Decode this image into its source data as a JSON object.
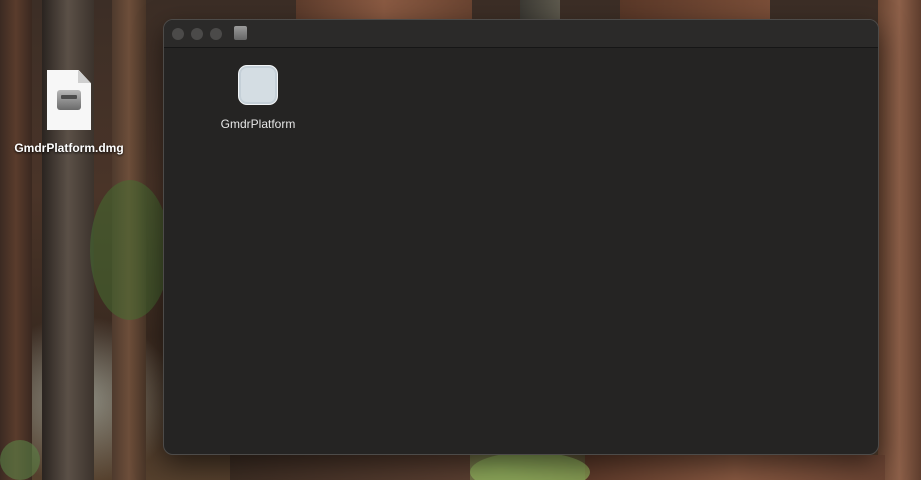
{
  "desktop": {
    "file": {
      "label": "GmdrPlatform.dmg",
      "icon": "disk-image-file-icon"
    }
  },
  "window": {
    "titlebar": {
      "close_icon": "close-button",
      "minimize_icon": "minimize-button",
      "zoom_icon": "zoom-button",
      "proxy_icon": "disk-volume-icon"
    },
    "items": [
      {
        "label": "GmdrPlatform",
        "icon": "app-icon"
      }
    ]
  },
  "colors": {
    "window_bg": "#252423",
    "titlebar_bg": "#2b2a29",
    "traffic_inactive": "#4b4a49",
    "icon_label_text": "#e6e6e6"
  }
}
